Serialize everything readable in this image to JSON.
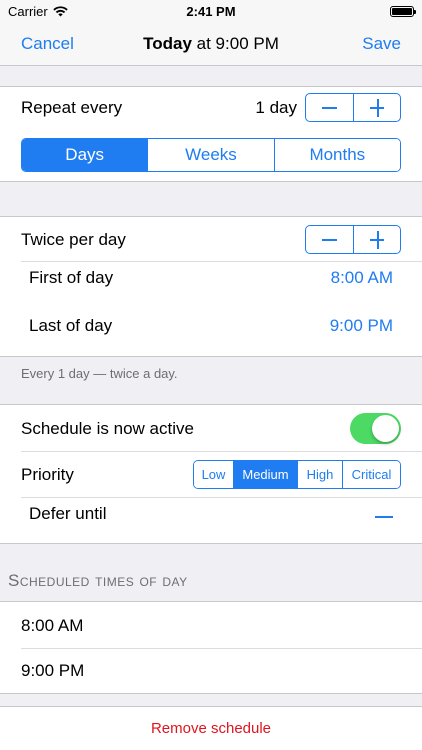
{
  "status_bar": {
    "carrier": "Carrier",
    "time": "2:41 PM"
  },
  "nav": {
    "cancel_label": "Cancel",
    "title_bold": "Today",
    "title_rest": " at 9:00 PM",
    "save_label": "Save"
  },
  "repeat": {
    "label": "Repeat every",
    "value": "1 day",
    "units": [
      "Days",
      "Weeks",
      "Months"
    ],
    "selected_unit": "Days"
  },
  "times_per_day": {
    "label": "Twice per day",
    "rows": [
      {
        "label": "First of day",
        "value": "8:00 AM"
      },
      {
        "label": "Last of day",
        "value": "9:00 PM"
      }
    ],
    "footer": "Every 1 day  — twice a day."
  },
  "settings": {
    "active_label": "Schedule is now active",
    "active": true,
    "priority_label": "Priority",
    "priority_options": [
      "Low",
      "Medium",
      "High",
      "Critical"
    ],
    "priority_selected": "Medium",
    "defer_label": "Defer until"
  },
  "scheduled_times": {
    "header": "Scheduled times of day",
    "items": [
      "8:00 AM",
      "9:00 PM"
    ]
  },
  "remove_label": "Remove schedule",
  "colors": {
    "accent": "#1f7cf1",
    "toggle_on": "#4cd964",
    "destructive": "#e0141f",
    "background": "#efeff4"
  }
}
